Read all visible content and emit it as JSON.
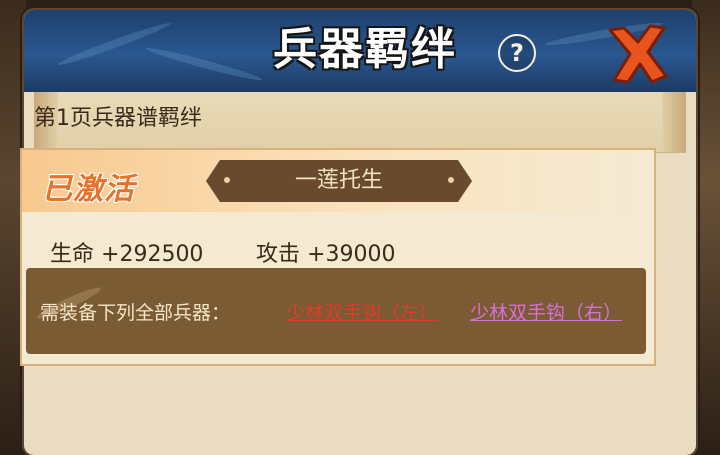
{
  "dialog": {
    "title": "兵器羁绊",
    "help_icon": "question-mark-icon",
    "close_icon": "close-x-icon"
  },
  "page": {
    "subtitle": "第1页兵器谱羁绊"
  },
  "bond_card": {
    "status": "已激活",
    "name": "一莲托生",
    "stats": [
      {
        "label": "生命",
        "value": "+292500"
      },
      {
        "label": "攻击",
        "value": "+39000"
      }
    ],
    "requirement": {
      "label": "需装备下列全部兵器：",
      "items": [
        "少林双手钩（左）",
        "少林双手钩（右）"
      ]
    }
  },
  "colors": {
    "header_blue": "#2a5890",
    "activated_orange": "#e8722a",
    "item1_color": "#e23a2a",
    "item2_color": "#d86fd8"
  }
}
